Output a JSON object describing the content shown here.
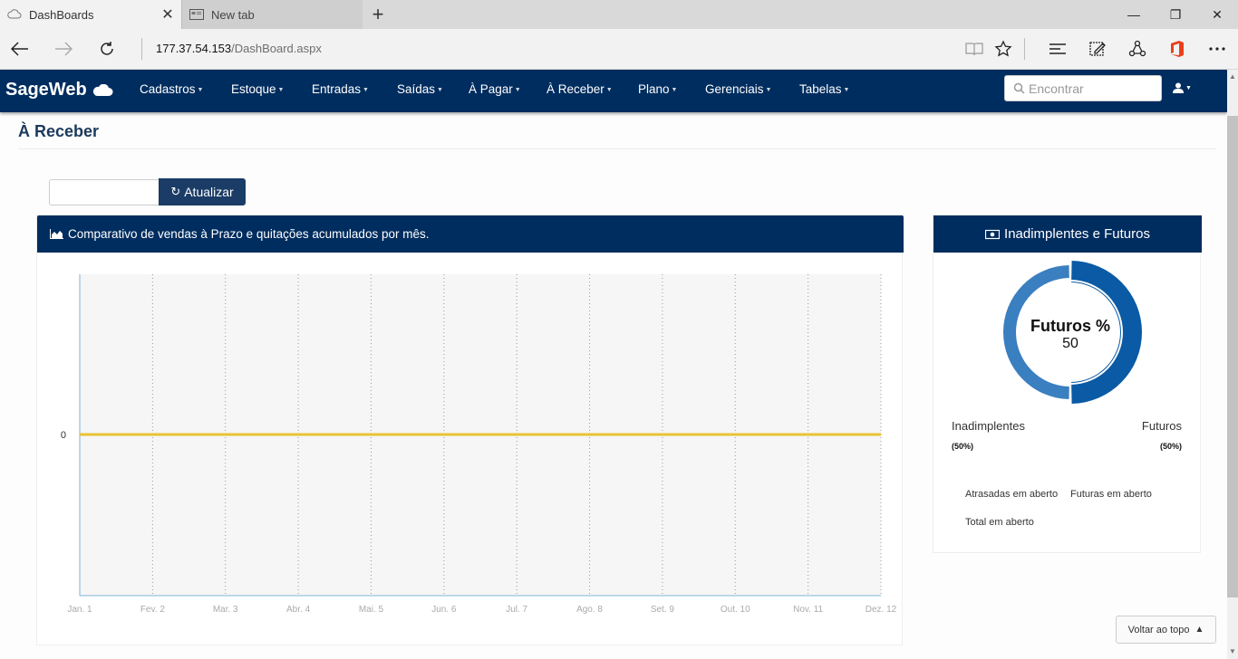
{
  "browser": {
    "tabs": [
      {
        "title": "DashBoards",
        "icon": "cloud-icon"
      },
      {
        "title": "New tab",
        "icon": "newtab-page-icon"
      }
    ],
    "url_host": "177.37.54.153",
    "url_path": "/DashBoard.aspx"
  },
  "navbar": {
    "brand": "SageWeb",
    "menu": [
      "Cadastros",
      "Estoque",
      "Entradas",
      "Saídas",
      "À Pagar",
      "À Receber",
      "Plano",
      "Gerenciais",
      "Tabelas"
    ],
    "search_placeholder": "Encontrar"
  },
  "page": {
    "title": "À Receber",
    "refresh_label": "Atualizar",
    "date_value": ""
  },
  "chart_panel": {
    "title": "Comparativo de vendas à Prazo e quitações acumulados por mês."
  },
  "chart_data": {
    "type": "line",
    "title": "Comparativo de vendas à Prazo e quitações acumulados por mês.",
    "categories": [
      "Jan. 1",
      "Fev. 2",
      "Mar. 3",
      "Abr. 4",
      "Mai. 5",
      "Jun. 6",
      "Jul. 7",
      "Ago. 8",
      "Set. 9",
      "Out. 10",
      "Nov. 11",
      "Dez. 12"
    ],
    "series": [
      {
        "values": [
          0,
          0,
          0,
          0,
          0,
          0,
          0,
          0,
          0,
          0,
          0,
          0
        ],
        "color": "#e8c235"
      }
    ],
    "y_ticks": [
      "0"
    ],
    "grid": "vertical-dotted"
  },
  "donut_panel": {
    "title": "Inadimplentes e Futuros",
    "center_label": "Futuros %",
    "center_value": "50",
    "slices": [
      {
        "label": "Inadimplentes",
        "percent_text": "(50%)",
        "value": 50,
        "color": "#3a7fc0"
      },
      {
        "label": "Futuros",
        "percent_text": "(50%)",
        "value": 50,
        "color": "#0a5aa5"
      }
    ],
    "summary": [
      "Atrasadas em aberto",
      "Futuras em aberto",
      "Total em aberto"
    ]
  },
  "back_to_top": "Voltar ao topo"
}
